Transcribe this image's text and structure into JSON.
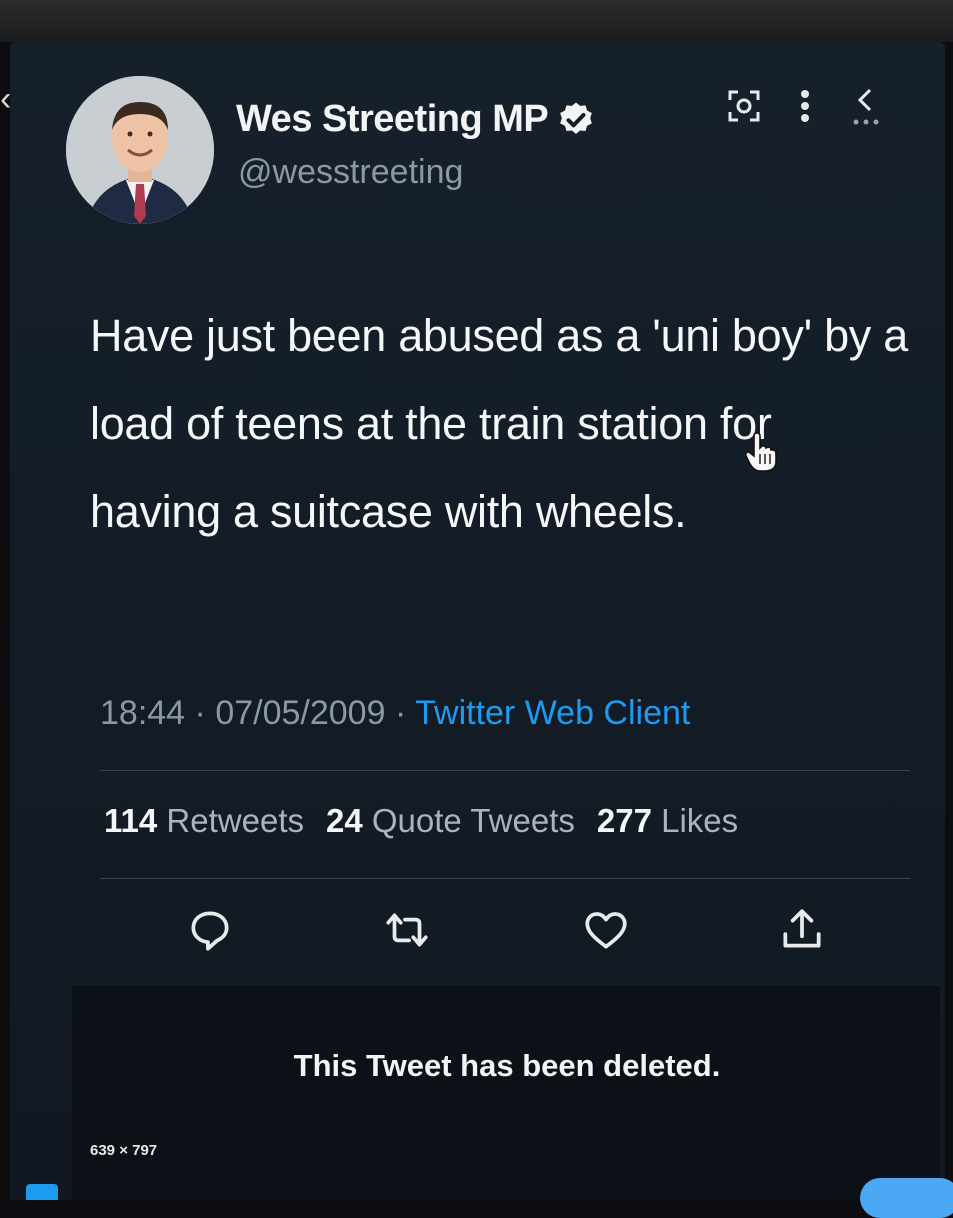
{
  "profile": {
    "display_name": "Wes Streeting MP",
    "handle": "@wesstreeting",
    "verified": true
  },
  "tweet": {
    "text": "Have just been abused as a 'uni boy' by a load of teens at the train station for having a suitcase with wheels.",
    "time": "18:44",
    "date": "07/05/2009",
    "separator": "·",
    "client": "Twitter Web Client"
  },
  "stats": {
    "retweets_count": "114",
    "retweets_label": "Retweets",
    "quotes_count": "24",
    "quotes_label": "Quote Tweets",
    "likes_count": "277",
    "likes_label": "Likes"
  },
  "notice": {
    "deleted": "This Tweet has been deleted."
  },
  "overlay": {
    "image_dimensions": "639 × 797"
  },
  "icons": {
    "top": [
      "screenshot-icon",
      "more-icon",
      "collapse-icon"
    ],
    "actions": [
      "reply-icon",
      "retweet-icon",
      "like-icon",
      "share-icon"
    ]
  },
  "colors": {
    "background": "#141d27",
    "accent": "#1d9bf0",
    "text": "#f4f6f8",
    "secondary_text": "#8b98a5"
  }
}
